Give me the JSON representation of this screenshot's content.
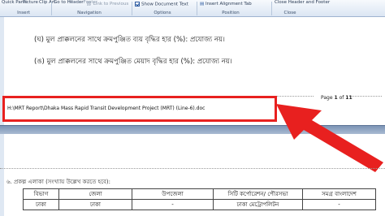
{
  "ribbon": {
    "quick_parts": "Quick Parts",
    "picture": "Picture",
    "clip_art": "Clip Art",
    "go_to_header": "Go to Header",
    "go_to_footer": "Go to Footer",
    "link_to_previous": "Link to Previous",
    "show_document_text": "Show Document Text",
    "insert_alignment_tab": "Insert Alignment Tab",
    "close_header_footer": "Close Header and Footer",
    "group_insert": "Insert",
    "group_navigation": "Navigation",
    "group_options": "Options",
    "group_position": "Position",
    "group_close": "Close"
  },
  "doc": {
    "line1": "(ঘ) মুল প্রাক্কলনের সাথে ক্রমপুঞ্জিত ব্যয় বৃদ্ধির হার (%): প্রযোজ্য নয়।",
    "line2": "(ঙ) মুল প্রাক্কলনের সাথে ক্রমপুঞ্জিত মেয়াদ বৃদ্ধির হার (%): প্রযোজ্য নয়।",
    "page_prefix": "Page",
    "page_current": "1",
    "page_of": "of",
    "page_total": "11",
    "footer_path": "H:\\MRT Report\\Dhaka Mass Rapid Transit Development Project (MRT) (Line-6).doc",
    "section_heading": "৬. প্রকল্প এলাকা (সংখ্যায় উল্লেখ করতে হবে):"
  },
  "table": {
    "headers": [
      "বিভাগ",
      "জেলা",
      "উপজেলা",
      "সিটি কর্পোরেশন/ পৌরসভা",
      "সমগ্র বাংলাদেশ"
    ],
    "row1": [
      "ঢাকা",
      "ঢাকা",
      "-",
      "ঢাকা মেট্রোপলিটন",
      "-"
    ]
  },
  "colors": {
    "callout": "#e8201f",
    "ribbon": "#dbe6f3"
  }
}
